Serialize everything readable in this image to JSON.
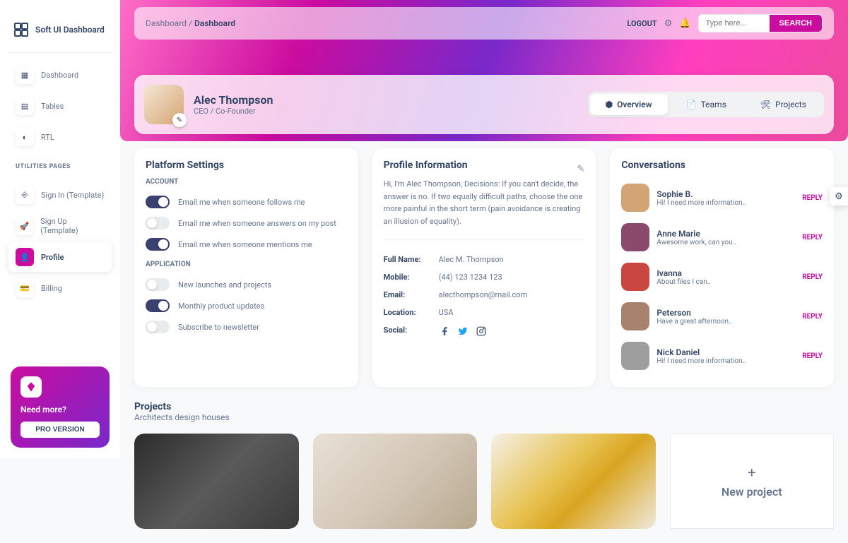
{
  "brand": {
    "text": "Soft UI Dashboard"
  },
  "nav": {
    "items": [
      {
        "label": "Dashboard",
        "icon": "▦"
      },
      {
        "label": "Tables",
        "icon": "▤"
      },
      {
        "label": "RTL",
        "icon": "◐"
      }
    ],
    "utilities_label": "UTILITIES PAGES",
    "utility_items": [
      {
        "label": "Sign In (Template)",
        "icon": "⎆"
      },
      {
        "label": "Sign Up (Template)",
        "icon": "🚀"
      },
      {
        "label": "Profile",
        "icon": "👤"
      },
      {
        "label": "Billing",
        "icon": "💳"
      }
    ]
  },
  "promo": {
    "title": "Need more?",
    "button": "PRO VERSION"
  },
  "breadcrumb": {
    "root": "Dashboard",
    "current": "Dashboard"
  },
  "top": {
    "logout": "LOGOUT",
    "search_placeholder": "Type here...",
    "search_btn": "SEARCH"
  },
  "profile": {
    "name": "Alec Thompson",
    "role": "CEO / Co-Founder",
    "tabs": [
      {
        "label": "Overview"
      },
      {
        "label": "Teams"
      },
      {
        "label": "Projects"
      }
    ]
  },
  "platform": {
    "title": "Platform Settings",
    "account_label": "ACCOUNT",
    "application_label": "APPLICATION",
    "account": [
      {
        "text": "Email me when someone follows me",
        "on": true
      },
      {
        "text": "Email me when someone answers on my post",
        "on": false
      },
      {
        "text": "Email me when someone mentions me",
        "on": true
      }
    ],
    "application": [
      {
        "text": "New launches and projects",
        "on": false
      },
      {
        "text": "Monthly product updates",
        "on": true
      },
      {
        "text": "Subscribe to newsletter",
        "on": false
      }
    ]
  },
  "info": {
    "title": "Profile Information",
    "bio": "Hi, I'm Alec Thompson, Decisions: If you can't decide, the answer is no. If two equally difficult paths, choose the one more painful in the short term (pain avoidance is creating an illusion of equality).",
    "rows": [
      {
        "label": "Full Name:",
        "value": "Alec M. Thompson"
      },
      {
        "label": "Mobile:",
        "value": "(44) 123 1234 123"
      },
      {
        "label": "Email:",
        "value": "alecthompson@mail.com"
      },
      {
        "label": "Location:",
        "value": "USA"
      }
    ],
    "social_label": "Social:"
  },
  "conversations": {
    "title": "Conversations",
    "items": [
      {
        "name": "Sophie B.",
        "msg": "Hi! I need more information..",
        "color": "#d4a574"
      },
      {
        "name": "Anne Marie",
        "msg": "Awesome work, can you..",
        "color": "#8b4a6b"
      },
      {
        "name": "Ivanna",
        "msg": "About files I can..",
        "color": "#c9473f"
      },
      {
        "name": "Peterson",
        "msg": "Have a great afternoon..",
        "color": "#a8826d"
      },
      {
        "name": "Nick Daniel",
        "msg": "Hi! I need more information..",
        "color": "#9e9e9e"
      }
    ],
    "reply": "REPLY"
  },
  "projects": {
    "title": "Projects",
    "subtitle": "Architects design houses",
    "new_label": "New project"
  }
}
